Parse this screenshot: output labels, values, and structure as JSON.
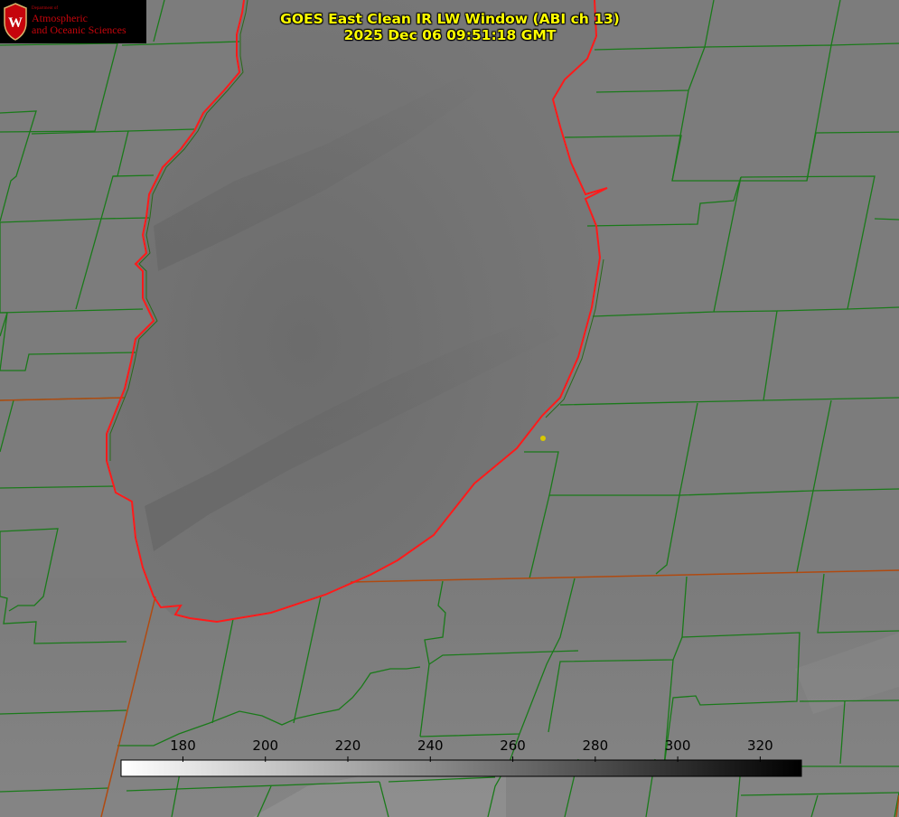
{
  "header": {
    "title_line1": "GOES East Clean IR LW Window (ABI ch 13)",
    "title_line2": "2025 Dec 06 09:51:18 GMT"
  },
  "logo": {
    "dept_small": "Department of",
    "line1": "Atmospheric",
    "line2": "and Oceanic Sciences",
    "shield_letter": "W",
    "icon": "uw-crest-icon",
    "color": "#c5050c"
  },
  "colorbar": {
    "min": 165,
    "max": 330,
    "ticks": [
      180,
      200,
      220,
      240,
      260,
      280,
      300,
      320
    ],
    "gradient": [
      "#ffffff",
      "#000000"
    ]
  },
  "map": {
    "boundary_colors": {
      "county": "#1a7a1a",
      "shoreline": "#ff1a1a",
      "state": "#b04a10"
    },
    "marker_color": "#d8c800"
  }
}
